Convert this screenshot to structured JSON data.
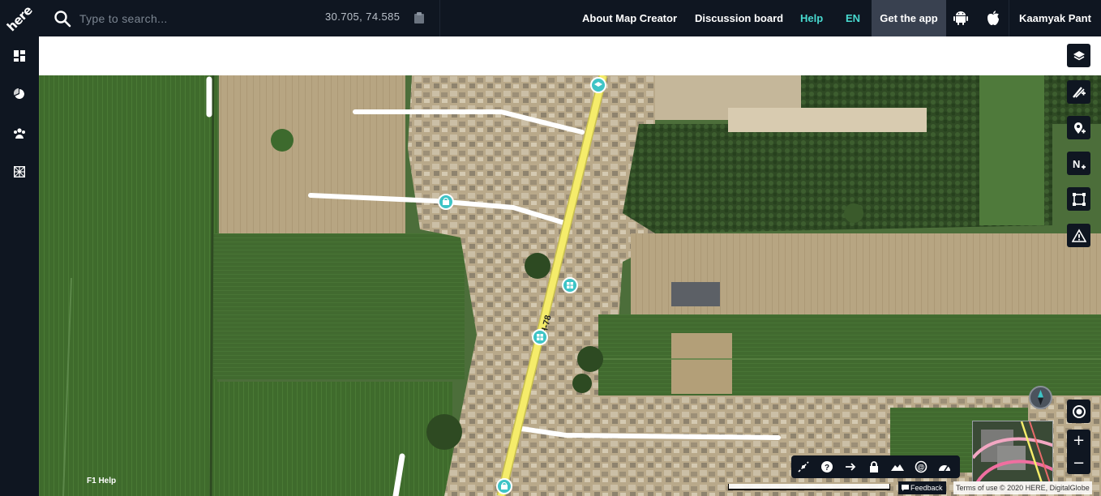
{
  "app": {
    "logo_text": "here"
  },
  "search": {
    "placeholder": "Type to search..."
  },
  "coordinates": "30.705, 74.585",
  "nav": {
    "about": "About Map Creator",
    "discussion": "Discussion board",
    "help": "Help",
    "language": "EN",
    "get_app": "Get the app",
    "user": "Kaamyak Pant"
  },
  "sidebar_icons": [
    "dashboard-icon",
    "pie-chart-icon",
    "community-icon",
    "grid-icon"
  ],
  "right_tools": [
    "layers-icon",
    "add-road-icon",
    "add-place-icon",
    "add-address-icon",
    "draw-area-icon",
    "warning-icon"
  ],
  "bottom_tools": [
    "split-road-icon",
    "help-circle-icon",
    "direction-arrow-icon",
    "lock-icon",
    "terrain-icon",
    "address-at-icon",
    "speed-gauge-icon"
  ],
  "map": {
    "road_label": "H-78"
  },
  "footer": {
    "help": "F1 Help",
    "feedback": "Feedback",
    "terms": "Terms of use © 2020 HERE, DigitalGlobe"
  },
  "zoom": {
    "in": "+",
    "out": "−"
  },
  "colors": {
    "topbar": "#0f1621",
    "accent_teal": "#48dad0",
    "road_yellow": "#f5ec6a",
    "poi_teal": "#3ec4c6"
  }
}
